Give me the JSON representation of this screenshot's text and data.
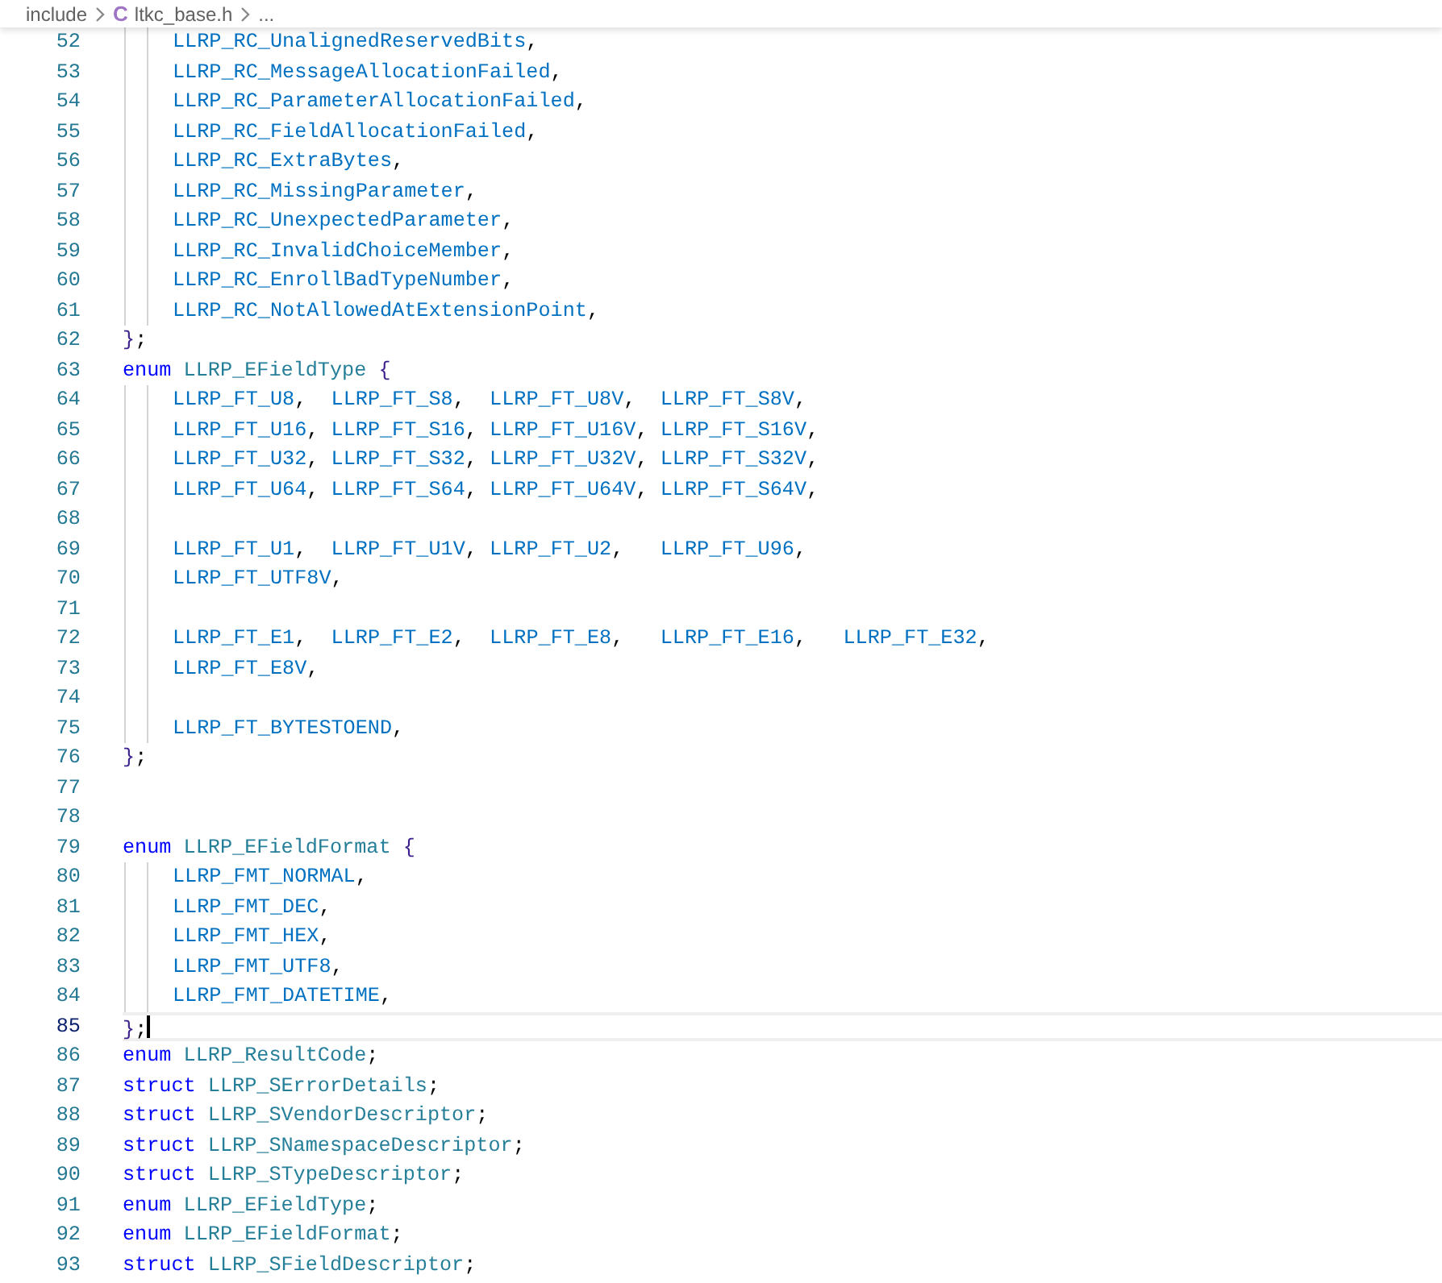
{
  "breadcrumb": [
    {
      "kind": "folder",
      "text": "include"
    },
    {
      "kind": "file",
      "icon": "C",
      "text": "ltkc_base.h"
    },
    {
      "kind": "more",
      "text": "..."
    }
  ],
  "lines": [
    {
      "number": "52",
      "indented": true,
      "current": false,
      "tokens": [
        {
          "kind": "member",
          "text": "LLRP_RC_UnalignedReservedBits"
        },
        {
          "kind": "punct",
          "text": ","
        }
      ]
    },
    {
      "number": "53",
      "indented": true,
      "current": false,
      "tokens": [
        {
          "kind": "member",
          "text": "LLRP_RC_MessageAllocationFailed"
        },
        {
          "kind": "punct",
          "text": ","
        }
      ]
    },
    {
      "number": "54",
      "indented": true,
      "current": false,
      "tokens": [
        {
          "kind": "member",
          "text": "LLRP_RC_ParameterAllocationFailed"
        },
        {
          "kind": "punct",
          "text": ","
        }
      ]
    },
    {
      "number": "55",
      "indented": true,
      "current": false,
      "tokens": [
        {
          "kind": "member",
          "text": "LLRP_RC_FieldAllocationFailed"
        },
        {
          "kind": "punct",
          "text": ","
        }
      ]
    },
    {
      "number": "56",
      "indented": true,
      "current": false,
      "tokens": [
        {
          "kind": "member",
          "text": "LLRP_RC_ExtraBytes"
        },
        {
          "kind": "punct",
          "text": ","
        }
      ]
    },
    {
      "number": "57",
      "indented": true,
      "current": false,
      "tokens": [
        {
          "kind": "member",
          "text": "LLRP_RC_MissingParameter"
        },
        {
          "kind": "punct",
          "text": ","
        }
      ]
    },
    {
      "number": "58",
      "indented": true,
      "current": false,
      "tokens": [
        {
          "kind": "member",
          "text": "LLRP_RC_UnexpectedParameter"
        },
        {
          "kind": "punct",
          "text": ","
        }
      ]
    },
    {
      "number": "59",
      "indented": true,
      "current": false,
      "tokens": [
        {
          "kind": "member",
          "text": "LLRP_RC_InvalidChoiceMember"
        },
        {
          "kind": "punct",
          "text": ","
        }
      ]
    },
    {
      "number": "60",
      "indented": true,
      "current": false,
      "tokens": [
        {
          "kind": "member",
          "text": "LLRP_RC_EnrollBadTypeNumber"
        },
        {
          "kind": "punct",
          "text": ","
        }
      ]
    },
    {
      "number": "61",
      "indented": true,
      "current": false,
      "tokens": [
        {
          "kind": "member",
          "text": "LLRP_RC_NotAllowedAtExtensionPoint"
        },
        {
          "kind": "punct",
          "text": ","
        }
      ]
    },
    {
      "number": "62",
      "indented": false,
      "current": false,
      "tokens": [
        {
          "kind": "brace",
          "text": "}"
        },
        {
          "kind": "punct",
          "text": ";"
        }
      ]
    },
    {
      "number": "63",
      "indented": false,
      "current": false,
      "tokens": [
        {
          "kind": "keyword",
          "text": "enum "
        },
        {
          "kind": "type",
          "text": "LLRP_EFieldType "
        },
        {
          "kind": "brace",
          "text": "{"
        }
      ]
    },
    {
      "number": "64",
      "indented": true,
      "current": false,
      "tokens": [
        {
          "kind": "member",
          "text": "LLRP_FT_U8"
        },
        {
          "kind": "punct",
          "text": ",  "
        },
        {
          "kind": "member",
          "text": "LLRP_FT_S8"
        },
        {
          "kind": "punct",
          "text": ",  "
        },
        {
          "kind": "member",
          "text": "LLRP_FT_U8V"
        },
        {
          "kind": "punct",
          "text": ",  "
        },
        {
          "kind": "member",
          "text": "LLRP_FT_S8V"
        },
        {
          "kind": "punct",
          "text": ","
        }
      ]
    },
    {
      "number": "65",
      "indented": true,
      "current": false,
      "tokens": [
        {
          "kind": "member",
          "text": "LLRP_FT_U16"
        },
        {
          "kind": "punct",
          "text": ", "
        },
        {
          "kind": "member",
          "text": "LLRP_FT_S16"
        },
        {
          "kind": "punct",
          "text": ", "
        },
        {
          "kind": "member",
          "text": "LLRP_FT_U16V"
        },
        {
          "kind": "punct",
          "text": ", "
        },
        {
          "kind": "member",
          "text": "LLRP_FT_S16V"
        },
        {
          "kind": "punct",
          "text": ","
        }
      ]
    },
    {
      "number": "66",
      "indented": true,
      "current": false,
      "tokens": [
        {
          "kind": "member",
          "text": "LLRP_FT_U32"
        },
        {
          "kind": "punct",
          "text": ", "
        },
        {
          "kind": "member",
          "text": "LLRP_FT_S32"
        },
        {
          "kind": "punct",
          "text": ", "
        },
        {
          "kind": "member",
          "text": "LLRP_FT_U32V"
        },
        {
          "kind": "punct",
          "text": ", "
        },
        {
          "kind": "member",
          "text": "LLRP_FT_S32V"
        },
        {
          "kind": "punct",
          "text": ","
        }
      ]
    },
    {
      "number": "67",
      "indented": true,
      "current": false,
      "tokens": [
        {
          "kind": "member",
          "text": "LLRP_FT_U64"
        },
        {
          "kind": "punct",
          "text": ", "
        },
        {
          "kind": "member",
          "text": "LLRP_FT_S64"
        },
        {
          "kind": "punct",
          "text": ", "
        },
        {
          "kind": "member",
          "text": "LLRP_FT_U64V"
        },
        {
          "kind": "punct",
          "text": ", "
        },
        {
          "kind": "member",
          "text": "LLRP_FT_S64V"
        },
        {
          "kind": "punct",
          "text": ","
        }
      ]
    },
    {
      "number": "68",
      "indented": true,
      "current": false
    },
    {
      "number": "69",
      "indented": true,
      "current": false,
      "tokens": [
        {
          "kind": "member",
          "text": "LLRP_FT_U1"
        },
        {
          "kind": "punct",
          "text": ",  "
        },
        {
          "kind": "member",
          "text": "LLRP_FT_U1V"
        },
        {
          "kind": "punct",
          "text": ", "
        },
        {
          "kind": "member",
          "text": "LLRP_FT_U2"
        },
        {
          "kind": "punct",
          "text": ",   "
        },
        {
          "kind": "member",
          "text": "LLRP_FT_U96"
        },
        {
          "kind": "punct",
          "text": ","
        }
      ]
    },
    {
      "number": "70",
      "indented": true,
      "current": false,
      "tokens": [
        {
          "kind": "member",
          "text": "LLRP_FT_UTF8V"
        },
        {
          "kind": "punct",
          "text": ","
        }
      ]
    },
    {
      "number": "71",
      "indented": true,
      "current": false
    },
    {
      "number": "72",
      "indented": true,
      "current": false,
      "tokens": [
        {
          "kind": "member",
          "text": "LLRP_FT_E1"
        },
        {
          "kind": "punct",
          "text": ",  "
        },
        {
          "kind": "member",
          "text": "LLRP_FT_E2"
        },
        {
          "kind": "punct",
          "text": ",  "
        },
        {
          "kind": "member",
          "text": "LLRP_FT_E8"
        },
        {
          "kind": "punct",
          "text": ",   "
        },
        {
          "kind": "member",
          "text": "LLRP_FT_E16"
        },
        {
          "kind": "punct",
          "text": ",   "
        },
        {
          "kind": "member",
          "text": "LLRP_FT_E32"
        },
        {
          "kind": "punct",
          "text": ","
        }
      ]
    },
    {
      "number": "73",
      "indented": true,
      "current": false,
      "tokens": [
        {
          "kind": "member",
          "text": "LLRP_FT_E8V"
        },
        {
          "kind": "punct",
          "text": ","
        }
      ]
    },
    {
      "number": "74",
      "indented": true,
      "current": false
    },
    {
      "number": "75",
      "indented": true,
      "current": false,
      "tokens": [
        {
          "kind": "member",
          "text": "LLRP_FT_BYTESTOEND"
        },
        {
          "kind": "punct",
          "text": ","
        }
      ]
    },
    {
      "number": "76",
      "indented": false,
      "current": false,
      "tokens": [
        {
          "kind": "brace",
          "text": "}"
        },
        {
          "kind": "punct",
          "text": ";"
        }
      ]
    },
    {
      "number": "77",
      "indented": false,
      "current": false
    },
    {
      "number": "78",
      "indented": false,
      "current": false
    },
    {
      "number": "79",
      "indented": false,
      "current": false,
      "tokens": [
        {
          "kind": "keyword",
          "text": "enum "
        },
        {
          "kind": "type",
          "text": "LLRP_EFieldFormat "
        },
        {
          "kind": "brace",
          "text": "{"
        }
      ]
    },
    {
      "number": "80",
      "indented": true,
      "current": false,
      "tokens": [
        {
          "kind": "member",
          "text": "LLRP_FMT_NORMAL"
        },
        {
          "kind": "punct",
          "text": ","
        }
      ]
    },
    {
      "number": "81",
      "indented": true,
      "current": false,
      "tokens": [
        {
          "kind": "member",
          "text": "LLRP_FMT_DEC"
        },
        {
          "kind": "punct",
          "text": ","
        }
      ]
    },
    {
      "number": "82",
      "indented": true,
      "current": false,
      "tokens": [
        {
          "kind": "member",
          "text": "LLRP_FMT_HEX"
        },
        {
          "kind": "punct",
          "text": ","
        }
      ]
    },
    {
      "number": "83",
      "indented": true,
      "current": false,
      "tokens": [
        {
          "kind": "member",
          "text": "LLRP_FMT_UTF8"
        },
        {
          "kind": "punct",
          "text": ","
        }
      ]
    },
    {
      "number": "84",
      "indented": true,
      "current": false,
      "tokens": [
        {
          "kind": "member",
          "text": "LLRP_FMT_DATETIME"
        },
        {
          "kind": "punct",
          "text": ","
        }
      ]
    },
    {
      "number": "85",
      "indented": false,
      "current": true,
      "tokens": [
        {
          "kind": "brace",
          "text": "}"
        },
        {
          "kind": "punct",
          "text": ";"
        }
      ]
    },
    {
      "number": "86",
      "indented": false,
      "current": false,
      "tokens": [
        {
          "kind": "keyword",
          "text": "enum "
        },
        {
          "kind": "type",
          "text": "LLRP_ResultCode"
        },
        {
          "kind": "punct",
          "text": ";"
        }
      ]
    },
    {
      "number": "87",
      "indented": false,
      "current": false,
      "tokens": [
        {
          "kind": "keyword",
          "text": "struct "
        },
        {
          "kind": "type",
          "text": "LLRP_SErrorDetails"
        },
        {
          "kind": "punct",
          "text": ";"
        }
      ]
    },
    {
      "number": "88",
      "indented": false,
      "current": false,
      "tokens": [
        {
          "kind": "keyword",
          "text": "struct "
        },
        {
          "kind": "type",
          "text": "LLRP_SVendorDescriptor"
        },
        {
          "kind": "punct",
          "text": ";"
        }
      ]
    },
    {
      "number": "89",
      "indented": false,
      "current": false,
      "tokens": [
        {
          "kind": "keyword",
          "text": "struct "
        },
        {
          "kind": "type",
          "text": "LLRP_SNamespaceDescriptor"
        },
        {
          "kind": "punct",
          "text": ";"
        }
      ]
    },
    {
      "number": "90",
      "indented": false,
      "current": false,
      "tokens": [
        {
          "kind": "keyword",
          "text": "struct "
        },
        {
          "kind": "type",
          "text": "LLRP_STypeDescriptor"
        },
        {
          "kind": "punct",
          "text": ";"
        }
      ]
    },
    {
      "number": "91",
      "indented": false,
      "current": false,
      "tokens": [
        {
          "kind": "keyword",
          "text": "enum "
        },
        {
          "kind": "type",
          "text": "LLRP_EFieldType"
        },
        {
          "kind": "punct",
          "text": ";"
        }
      ]
    },
    {
      "number": "92",
      "indented": false,
      "current": false,
      "tokens": [
        {
          "kind": "keyword",
          "text": "enum "
        },
        {
          "kind": "type",
          "text": "LLRP_EFieldFormat"
        },
        {
          "kind": "punct",
          "text": ";"
        }
      ]
    },
    {
      "number": "93",
      "indented": false,
      "current": false,
      "tokens": [
        {
          "kind": "keyword",
          "text": "struct "
        },
        {
          "kind": "type",
          "text": "LLRP_SFieldDescriptor"
        },
        {
          "kind": "punct",
          "text": ";"
        }
      ]
    }
  ]
}
